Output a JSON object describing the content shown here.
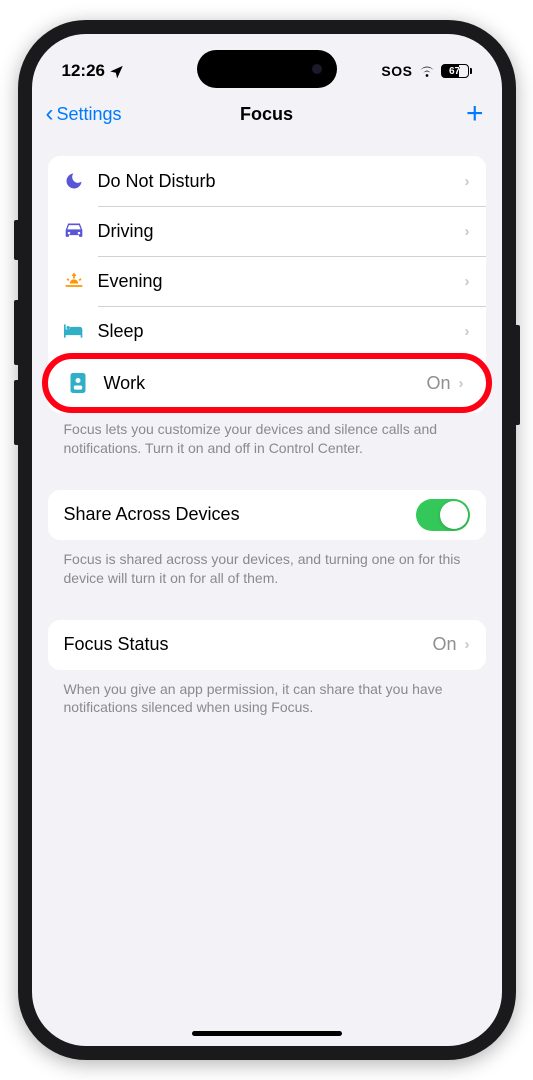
{
  "statusBar": {
    "time": "12:26",
    "sos": "SOS",
    "battery": "67"
  },
  "nav": {
    "back": "Settings",
    "title": "Focus"
  },
  "focus": {
    "items": [
      {
        "label": "Do Not Disturb",
        "value": "",
        "color": "#5856d6"
      },
      {
        "label": "Driving",
        "value": "",
        "color": "#5856d6"
      },
      {
        "label": "Evening",
        "value": "",
        "color": "#ff9500"
      },
      {
        "label": "Sleep",
        "value": "",
        "color": "#30b0c7"
      },
      {
        "label": "Work",
        "value": "On",
        "color": "#30b0c7"
      }
    ],
    "footer": "Focus lets you customize your devices and silence calls and notifications. Turn it on and off in Control Center."
  },
  "share": {
    "label": "Share Across Devices",
    "footer": "Focus is shared across your devices, and turning one on for this device will turn it on for all of them."
  },
  "status": {
    "label": "Focus Status",
    "value": "On",
    "footer": "When you give an app permission, it can share that you have notifications silenced when using Focus."
  }
}
